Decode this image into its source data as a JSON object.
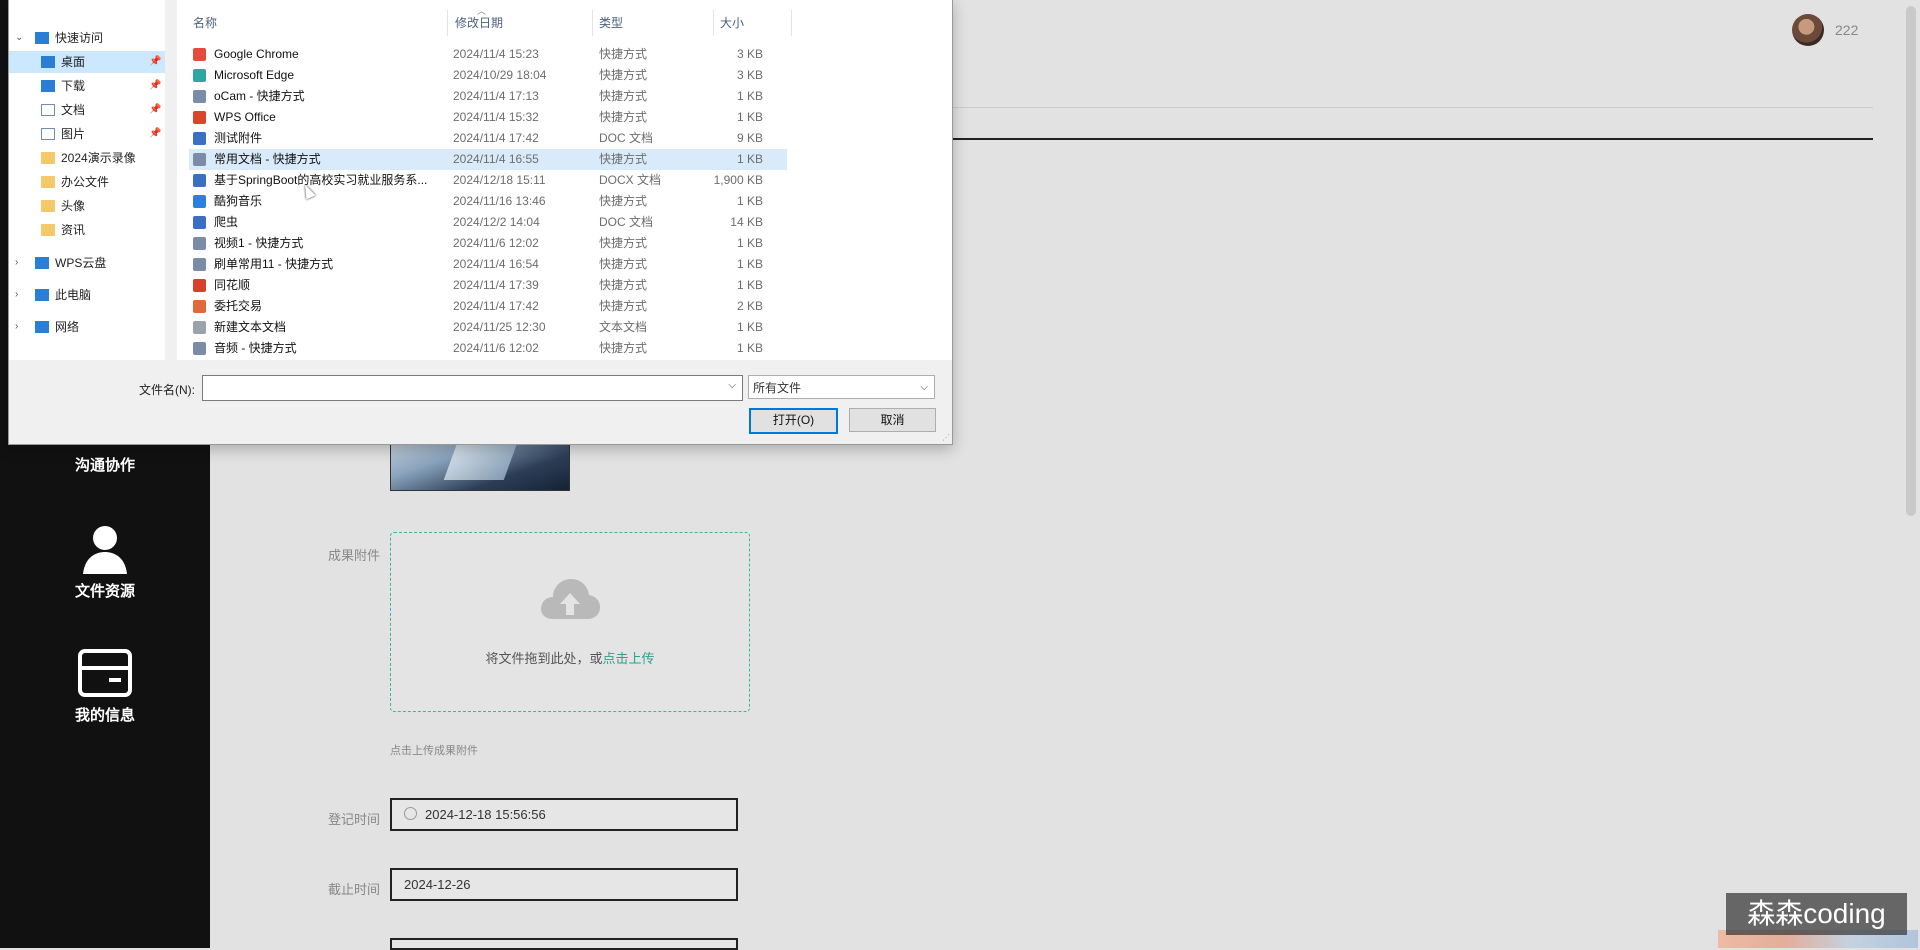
{
  "sidebar": {
    "items": [
      {
        "label": "沟通协作",
        "icon": "chat-icon"
      },
      {
        "label": "文件资源",
        "icon": "user-icon"
      },
      {
        "label": "我的信息",
        "icon": "card-icon"
      }
    ]
  },
  "header": {
    "username": "222"
  },
  "form": {
    "attachment_label": "成果附件",
    "upload_text": "将文件拖到此处，或",
    "upload_link": "点击上传",
    "upload_tip": "点击上传成果附件",
    "register_time_label": "登记时间",
    "register_time_value": "2024-12-18 15:56:56",
    "deadline_label": "截止时间",
    "deadline_value": "2024-12-26"
  },
  "watermark": "森森coding",
  "dialog": {
    "nav": [
      {
        "label": "快速访问",
        "type": "quick",
        "chevron": "⌄"
      },
      {
        "label": "桌面",
        "type": "desktop",
        "pinned": true,
        "selected": true
      },
      {
        "label": "下载",
        "type": "download",
        "pinned": true
      },
      {
        "label": "文档",
        "type": "document",
        "pinned": true
      },
      {
        "label": "图片",
        "type": "picture",
        "pinned": true
      },
      {
        "label": "2024演示录像",
        "type": "folder"
      },
      {
        "label": "办公文件",
        "type": "folder"
      },
      {
        "label": "头像",
        "type": "folder"
      },
      {
        "label": "资讯",
        "type": "folder"
      },
      {
        "label": "WPS云盘",
        "type": "cloud",
        "chevron": "›"
      },
      {
        "label": "此电脑",
        "type": "pc",
        "chevron": "›"
      },
      {
        "label": "网络",
        "type": "network",
        "chevron": "›"
      }
    ],
    "columns": {
      "name": "名称",
      "date": "修改日期",
      "type": "类型",
      "size": "大小"
    },
    "files": [
      {
        "name": "Google Chrome",
        "date": "2024/11/4 15:23",
        "type": "快捷方式",
        "size": "3 KB",
        "color": "#e44b3a"
      },
      {
        "name": "Microsoft Edge",
        "date": "2024/10/29 18:04",
        "type": "快捷方式",
        "size": "3 KB",
        "color": "#2fa7a0"
      },
      {
        "name": "oCam - 快捷方式",
        "date": "2024/11/4 17:13",
        "type": "快捷方式",
        "size": "1 KB",
        "color": "#7a8ca8"
      },
      {
        "name": "WPS Office",
        "date": "2024/11/4 15:32",
        "type": "快捷方式",
        "size": "1 KB",
        "color": "#d9452b"
      },
      {
        "name": "测试附件",
        "date": "2024/11/4 17:42",
        "type": "DOC 文档",
        "size": "9 KB",
        "color": "#3b6fc2"
      },
      {
        "name": "常用文档 - 快捷方式",
        "date": "2024/11/4 16:55",
        "type": "快捷方式",
        "size": "1 KB",
        "color": "#7a8ca8",
        "selected": true
      },
      {
        "name": "基于SpringBoot的高校实习就业服务系...",
        "date": "2024/12/18 15:11",
        "type": "DOCX 文档",
        "size": "1,900 KB",
        "color": "#3b6fc2"
      },
      {
        "name": "酷狗音乐",
        "date": "2024/11/16 13:46",
        "type": "快捷方式",
        "size": "1 KB",
        "color": "#2b7fe0"
      },
      {
        "name": "爬虫",
        "date": "2024/12/2 14:04",
        "type": "DOC 文档",
        "size": "14 KB",
        "color": "#3b6fc2"
      },
      {
        "name": "视频1 - 快捷方式",
        "date": "2024/11/6 12:02",
        "type": "快捷方式",
        "size": "1 KB",
        "color": "#7a8ca8"
      },
      {
        "name": "刷单常用11 - 快捷方式",
        "date": "2024/11/4 16:54",
        "type": "快捷方式",
        "size": "1 KB",
        "color": "#7a8ca8"
      },
      {
        "name": "同花顺",
        "date": "2024/11/4 17:39",
        "type": "快捷方式",
        "size": "1 KB",
        "color": "#d8402e"
      },
      {
        "name": "委托交易",
        "date": "2024/11/4 17:42",
        "type": "快捷方式",
        "size": "2 KB",
        "color": "#e0683a"
      },
      {
        "name": "新建文本文档",
        "date": "2024/11/25 12:30",
        "type": "文本文档",
        "size": "1 KB",
        "color": "#9aa3ad"
      },
      {
        "name": "音频 - 快捷方式",
        "date": "2024/11/6 12:02",
        "type": "快捷方式",
        "size": "1 KB",
        "color": "#7a8ca8"
      }
    ],
    "filename_label": "文件名(N):",
    "filename_value": "",
    "filter_value": "所有文件",
    "open_label": "打开(O)",
    "cancel_label": "取消"
  }
}
